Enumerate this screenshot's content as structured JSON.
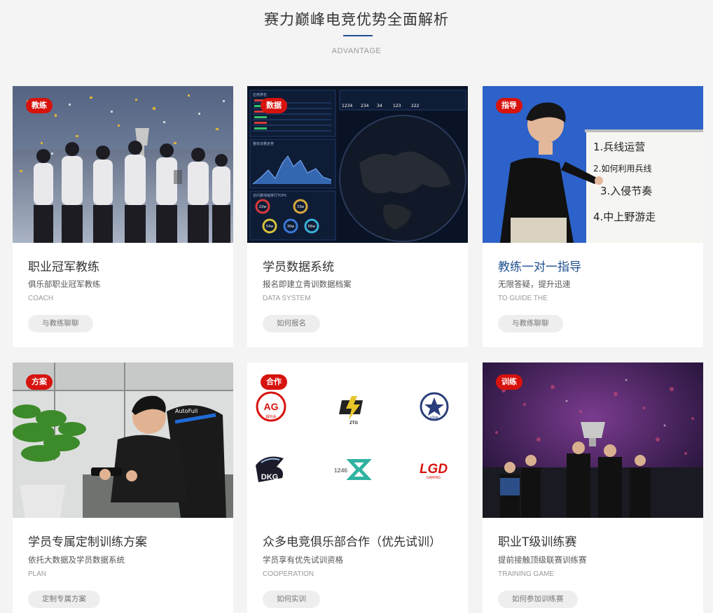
{
  "header": {
    "title": "赛力巅峰电竞优势全面解析",
    "subtitle": "ADVANTAGE",
    "accent_color": "#1e4f8f"
  },
  "colors": {
    "tag_red": "#d7130e",
    "background": "#f4f4f4",
    "card": "#ffffff"
  },
  "cards": [
    {
      "tag": "教练",
      "title": "职业冠军教练",
      "desc": "俱乐部职业冠军教练",
      "en": "COACH",
      "button": "与教练聊聊",
      "image": "champions-celebration-photo"
    },
    {
      "tag": "数据",
      "title": "学员数据系统",
      "desc": "报名即建立青训数据档案",
      "en": "DATA SYSTEM",
      "button": "如何报名",
      "image": "data-dashboard-screenshot",
      "dashboard": {
        "stats": [
          "1234",
          "234",
          "34",
          "123",
          "222"
        ],
        "top_left": "应用排名",
        "mid_left": "整体流量走势",
        "bottom_left": "访问量地域排行TOP5",
        "rings": [
          "22w",
          "33w",
          "54w",
          "30w",
          "66w"
        ]
      }
    },
    {
      "tag": "指导",
      "title": "教练一对一指导",
      "desc": "无限答疑，提升迅速",
      "en": "TO GUIDE THE",
      "button": "与教练聊聊",
      "image": "coach-whiteboard-photo",
      "whiteboard": [
        "1.兵线运营",
        "2.如何利用兵线",
        "3.入侵节奏",
        "4.中上野游走"
      ]
    },
    {
      "tag": "方案",
      "title": "学员专属定制训练方案",
      "desc": "依托大数据及学员数据系统",
      "en": "PLAN",
      "button": "定制专属方案",
      "image": "student-playing-phone-photo",
      "chair_brand": "AutoFull"
    },
    {
      "tag": "合作",
      "title": "众多电竞俱乐部合作（优先试训）",
      "desc": "学员享有优先试训资格",
      "en": "COOPERATION",
      "button": "如何实训",
      "image": "club-logos",
      "logos": [
        "AG",
        "ZTG",
        "eStar",
        "DKG",
        "1246",
        "LGD"
      ],
      "logo_sub": {
        "ag": "超玩会",
        "lgd": "GAMING"
      }
    },
    {
      "tag": "训练",
      "title": "职业T级训练赛",
      "desc": "提前接触顶级联赛训练赛",
      "en": "TRAINING GAME",
      "button": "如何参加训练赛",
      "image": "trophy-stage-photo"
    }
  ]
}
